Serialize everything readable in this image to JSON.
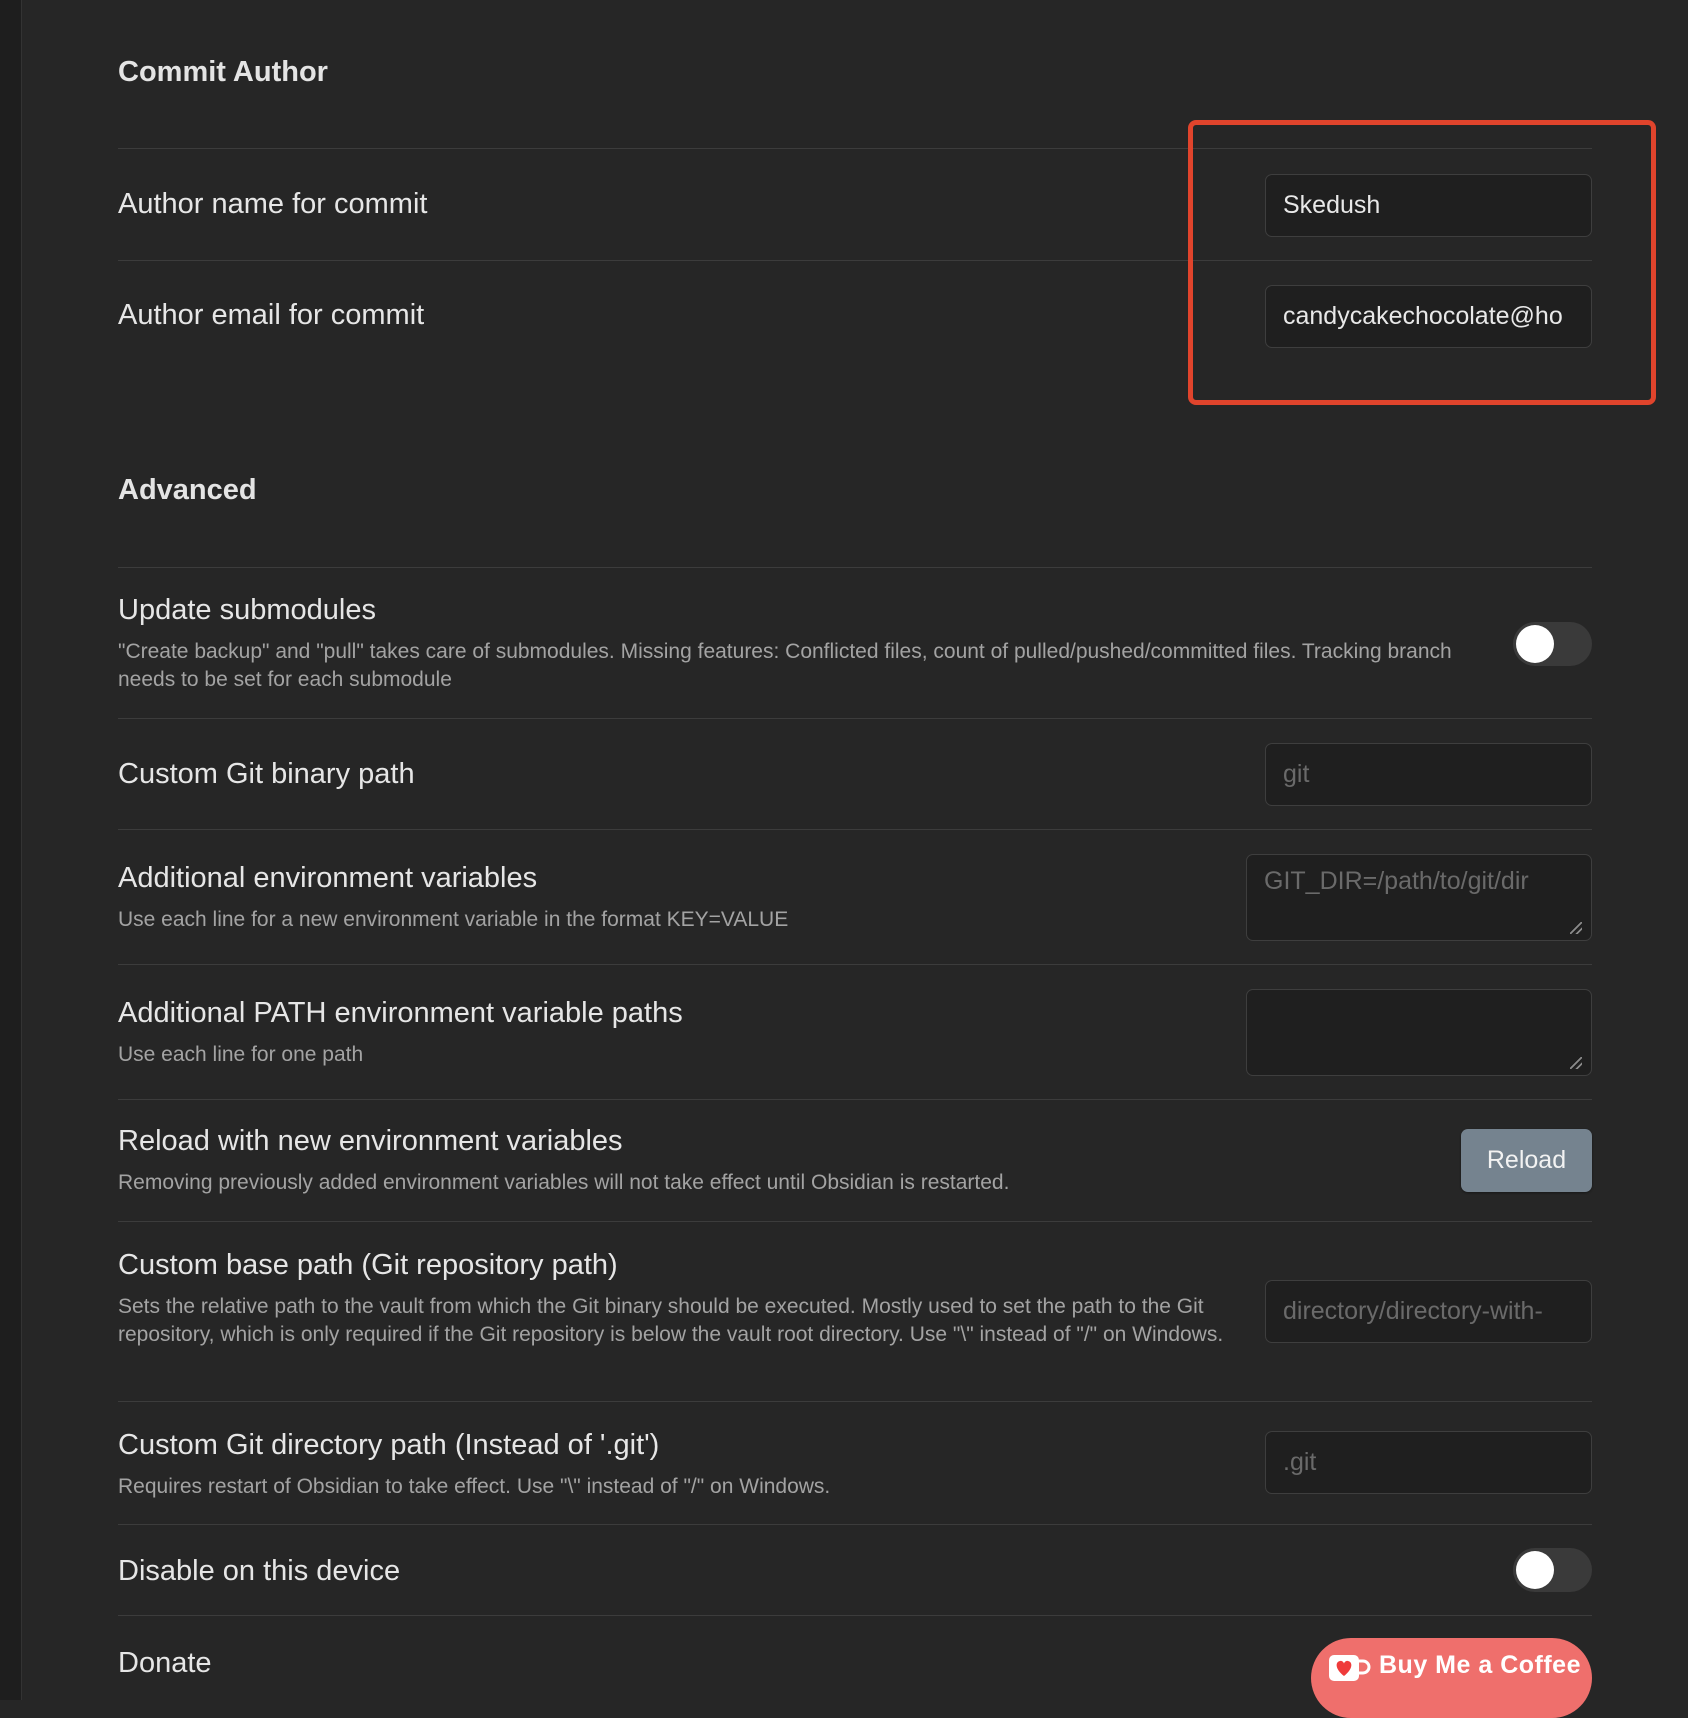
{
  "commit_author": {
    "heading": "Commit Author",
    "author_name": {
      "label": "Author name for commit",
      "value": "Skedush"
    },
    "author_email": {
      "label": "Author email for commit",
      "value": "candycakechocolate@ho"
    }
  },
  "advanced": {
    "heading": "Advanced",
    "update_submodules": {
      "label": "Update submodules",
      "description": "\"Create backup\" and \"pull\" takes care of submodules. Missing features: Conflicted files, count of pulled/pushed/committed files. Tracking branch needs to be set for each submodule",
      "enabled": false
    },
    "git_binary_path": {
      "label": "Custom Git binary path",
      "placeholder": "git"
    },
    "env_vars": {
      "label": "Additional environment variables",
      "description": "Use each line for a new environment variable in the format KEY=VALUE",
      "placeholder": "GIT_DIR=/path/to/git/dir"
    },
    "path_vars": {
      "label": "Additional PATH environment variable paths",
      "description": "Use each line for one path",
      "placeholder": ""
    },
    "reload": {
      "label": "Reload with new environment variables",
      "description": "Removing previously added environment variables will not take effect until Obsidian is restarted.",
      "button": "Reload"
    },
    "base_path": {
      "label": "Custom base path (Git repository path)",
      "description": "Sets the relative path to the vault from which the Git binary should be executed. Mostly used to set the path to the Git repository, which is only required if the Git repository is below the vault root directory. Use \"\\\" instead of \"/\" on Windows.",
      "placeholder": "directory/directory-with-"
    },
    "git_dir_path": {
      "label": "Custom Git directory path (Instead of '.git')",
      "description": "Requires restart of Obsidian to take effect. Use \"\\\" instead of \"/\" on Windows.",
      "placeholder": ".git"
    },
    "disable_device": {
      "label": "Disable on this device",
      "enabled": false
    }
  },
  "donate": {
    "heading": "Donate",
    "button": "Buy Me a Coffee",
    "icon": "coffee-cup-heart-icon"
  },
  "colors": {
    "background": "#262626",
    "highlight_box": "#e0442c",
    "reload_button": "#75838f",
    "coffee_button": "#ef6f6c"
  }
}
